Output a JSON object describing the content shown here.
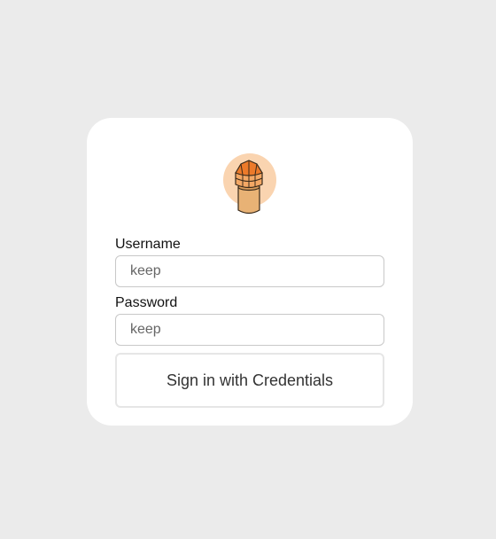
{
  "logo": {
    "icon": "lighthouse-icon",
    "halo_color": "#fad4b0",
    "roof_color": "#ec7a2a",
    "body_color": "#e8b275"
  },
  "form": {
    "username_label": "Username",
    "username_value": "keep",
    "password_label": "Password",
    "password_value": "keep",
    "submit_label": "Sign in with Credentials"
  }
}
